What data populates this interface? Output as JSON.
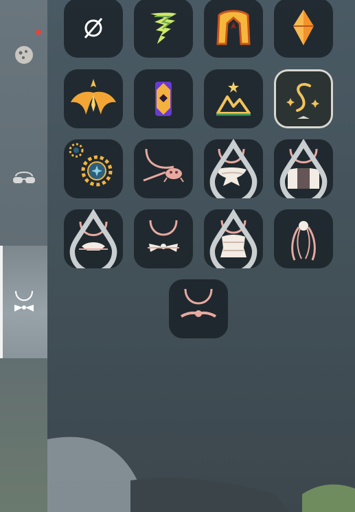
{
  "sidebar": {
    "tabs": [
      {
        "name": "mask",
        "icon": "mask-icon",
        "selected": false,
        "notification": true
      },
      {
        "name": "accessory",
        "icon": "glasses-icon",
        "selected": false,
        "notification": false
      },
      {
        "name": "neck",
        "icon": "necklace-bow-icon",
        "selected": true,
        "notification": false
      }
    ],
    "notification_color": "#e0463c"
  },
  "grid": {
    "columns": 4,
    "items": [
      {
        "icon": "none-icon",
        "selected": false,
        "droplet": false
      },
      {
        "icon": "tornado-spell-icon",
        "selected": false,
        "droplet": false
      },
      {
        "icon": "golden-arch-spell-icon",
        "selected": false,
        "droplet": false
      },
      {
        "icon": "orange-crystal-spell-icon",
        "selected": false,
        "droplet": false
      },
      {
        "icon": "golden-wings-spell-icon",
        "selected": false,
        "droplet": false
      },
      {
        "icon": "purple-lantern-spell-icon",
        "selected": false,
        "droplet": false
      },
      {
        "icon": "mountain-star-spell-icon",
        "selected": false,
        "droplet": false
      },
      {
        "icon": "sparkle-swirl-spell-icon",
        "selected": true,
        "droplet": false
      },
      {
        "icon": "sun-gear-spell-icon",
        "selected": false,
        "droplet": false
      },
      {
        "icon": "necklace-crab-icon",
        "selected": false,
        "droplet": false
      },
      {
        "icon": "necklace-scarf-icon",
        "selected": false,
        "droplet": true
      },
      {
        "icon": "necklace-cape-icon",
        "selected": false,
        "droplet": true
      },
      {
        "icon": "necklace-shell-icon",
        "selected": false,
        "droplet": true
      },
      {
        "icon": "necklace-bow-icon",
        "selected": false,
        "droplet": false
      },
      {
        "icon": "necklace-wrap-icon",
        "selected": false,
        "droplet": true
      },
      {
        "icon": "necklace-pearl-icon",
        "selected": false,
        "droplet": false
      },
      {
        "icon": "necklace-ribbon-icon",
        "selected": false,
        "droplet": false
      }
    ]
  },
  "colors": {
    "gold": "#f2b443",
    "necklace": "#e8a9a0",
    "teal_glow": "#3fa0a8",
    "slot_bg": "#161e23"
  }
}
